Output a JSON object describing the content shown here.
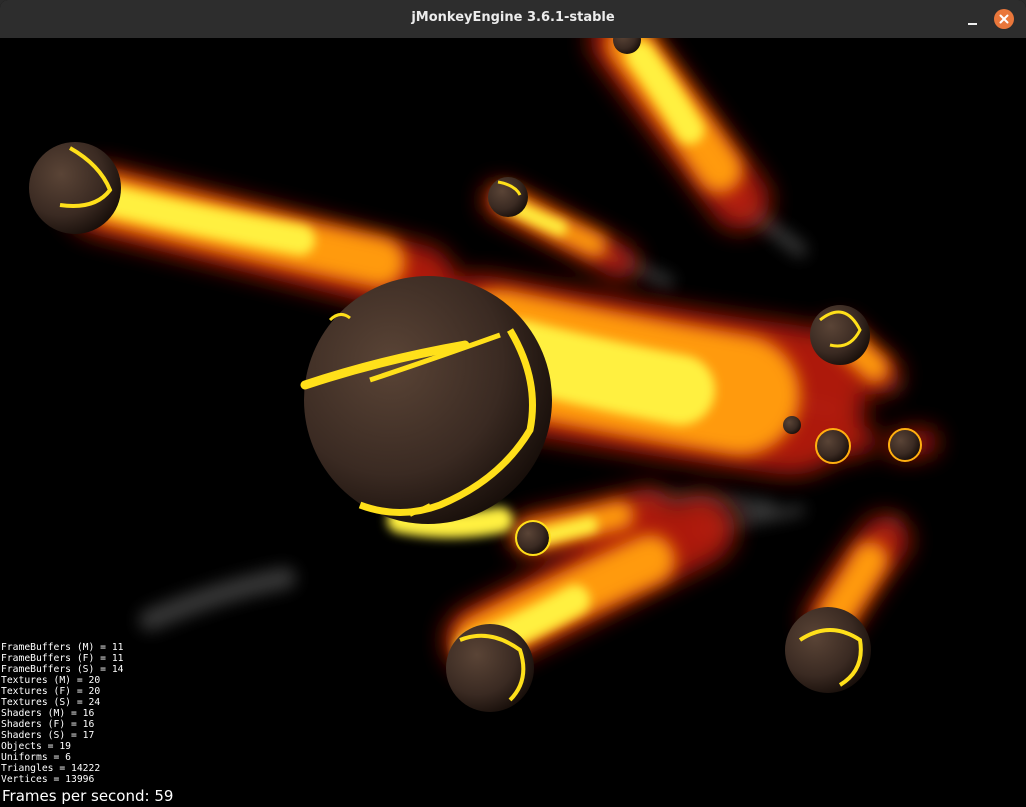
{
  "window": {
    "title": "jMonkeyEngine 3.6.1-stable",
    "controls": {
      "minimize_icon": "minimize-icon",
      "close_icon": "close-icon",
      "close_color": "#e9773b"
    }
  },
  "scene": {
    "description_icon": "fire-meteor-scene",
    "colors": {
      "background": "#000000",
      "rock": "#3a2a22",
      "lava": "#ffe01a",
      "flame_core": "#fff040",
      "flame_mid": "#ff9a10",
      "flame_edge": "#c01a08",
      "smoke": "#7a7a7a"
    }
  },
  "stats": {
    "lines": [
      "FrameBuffers (M) = 11",
      "FrameBuffers (F) = 11",
      "FrameBuffers (S) = 14",
      "Textures (M) = 20",
      "Textures (F) = 20",
      "Textures (S) = 24",
      "Shaders (M) = 16",
      "Shaders (F) = 16",
      "Shaders (S) = 17",
      "Objects = 19",
      "Uniforms = 6",
      "Triangles = 14222",
      "Vertices = 13996"
    ],
    "fps_label": "Frames per second: 59"
  }
}
